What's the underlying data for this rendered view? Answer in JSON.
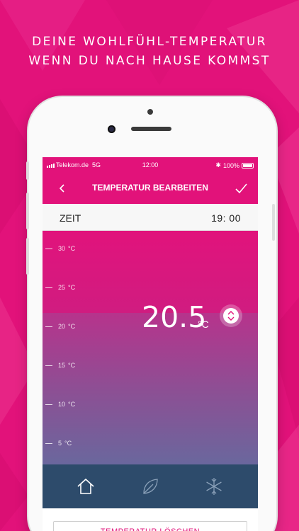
{
  "headline": {
    "line1": "DEINE WOHLFÜHL-TEMPERATUR",
    "line2": "WENN DU NACH HAUSE KOMMST"
  },
  "status_bar": {
    "carrier": "Telekom.de",
    "network": "5G",
    "time": "12:00",
    "battery": "100%"
  },
  "navbar": {
    "title": "TEMPERATUR BEARBEITEN",
    "back_icon": "chevron-left-icon",
    "confirm_icon": "checkmark-icon"
  },
  "time_row": {
    "label": "ZEIT",
    "value": "19: 00"
  },
  "scale": {
    "unit": "°C",
    "ticks": [
      {
        "value": "30"
      },
      {
        "value": "25"
      },
      {
        "value": "20"
      },
      {
        "value": "15"
      },
      {
        "value": "10"
      },
      {
        "value": "5"
      }
    ]
  },
  "temperature": {
    "value": "20.5",
    "unit": "°C"
  },
  "tabs": [
    {
      "icon": "home-icon"
    },
    {
      "icon": "leaf-icon"
    },
    {
      "icon": "snowflake-icon"
    }
  ],
  "delete_button": {
    "label": "TEMPERATUR LÖSCHEN"
  },
  "colors": {
    "accent": "#e2127a",
    "tabbar": "#2d4b6b"
  }
}
